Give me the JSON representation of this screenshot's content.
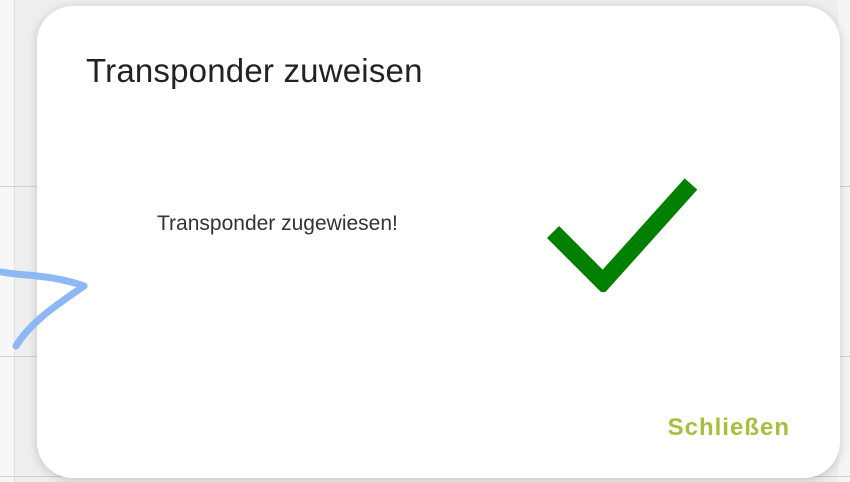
{
  "dialog": {
    "title": "Transponder zuweisen",
    "message": "Transponder zugewiesen!",
    "status_icon": "check-icon",
    "close_label": "Schließen"
  },
  "annotation": {
    "icon": "arrow-icon"
  },
  "colors": {
    "check": "#008000",
    "accent": "#a8bf3e",
    "arrow": "#8db8f5"
  }
}
